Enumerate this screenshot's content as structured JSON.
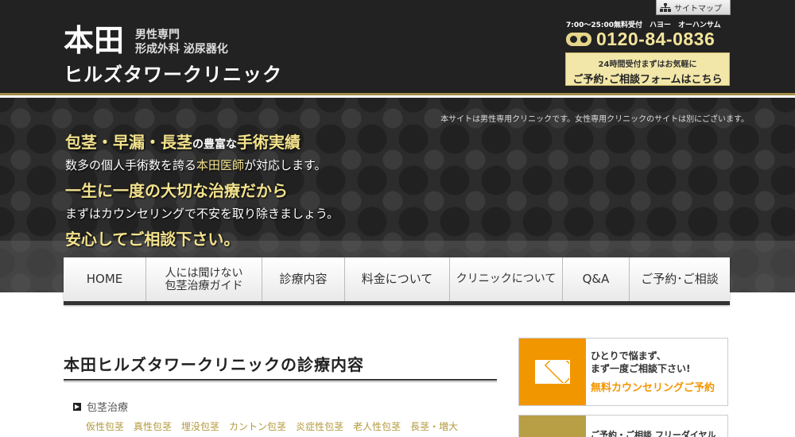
{
  "header": {
    "logo_main": "本田",
    "logo_sub1": "男性専門",
    "logo_sub2": "形成外科 泌尿器化",
    "logo_name": "ヒルズタワークリニック",
    "sitemap_label": "サイトマップ",
    "tel_hours": "7:00〜25:00無料受付　ハヨー　オーハンサム",
    "tel_number": "0120-84-0836",
    "reserve_line1": "24時間受付まずはお気軽に",
    "reserve_line2": "ご予約･ご相談フォームはこちら"
  },
  "hero": {
    "notice": "本サイトは男性専用クリニックです。女性専用クリニックのサイトは別にございます。",
    "line1_gold": "包茎・早漏・長茎",
    "line1_small1": "の",
    "line1_small2": "豊富な",
    "line1_gold2": "手術実績",
    "line2_a": "数多の個人手術数を誇る",
    "line2_gold": "本田医師",
    "line2_b": "が対応します。",
    "line3": "一生に一度の大切な治療だから",
    "line4": "まずはカウンセリングで不安を取り除きましょう。",
    "line5": "安心してご相談下さい。"
  },
  "nav": {
    "items": [
      {
        "label": "HOME"
      },
      {
        "label_a": "人には聞けない",
        "label_b": "包茎治療ガイド"
      },
      {
        "label": "診療内容"
      },
      {
        "label": "料金について"
      },
      {
        "label": "クリニックについて"
      },
      {
        "label": "Q&A"
      },
      {
        "label": "ご予約･ご相談"
      }
    ]
  },
  "main": {
    "title": "本田ヒルズタワークリニックの診療内容",
    "section_heading": "包茎治療",
    "links": [
      "仮性包茎",
      "真性包茎",
      "埋没包茎",
      "カントン包茎",
      "炎症性包茎",
      "老人性包茎",
      "長茎・増大"
    ]
  },
  "sidebar": {
    "counsel_l1": "ひとりで悩まず、",
    "counsel_l2": "まず一度ご相談下さい!",
    "counsel_l3": "無料カウンセリングご予約",
    "dial_label": "ご予約・ご相談 フリーダイヤル"
  }
}
